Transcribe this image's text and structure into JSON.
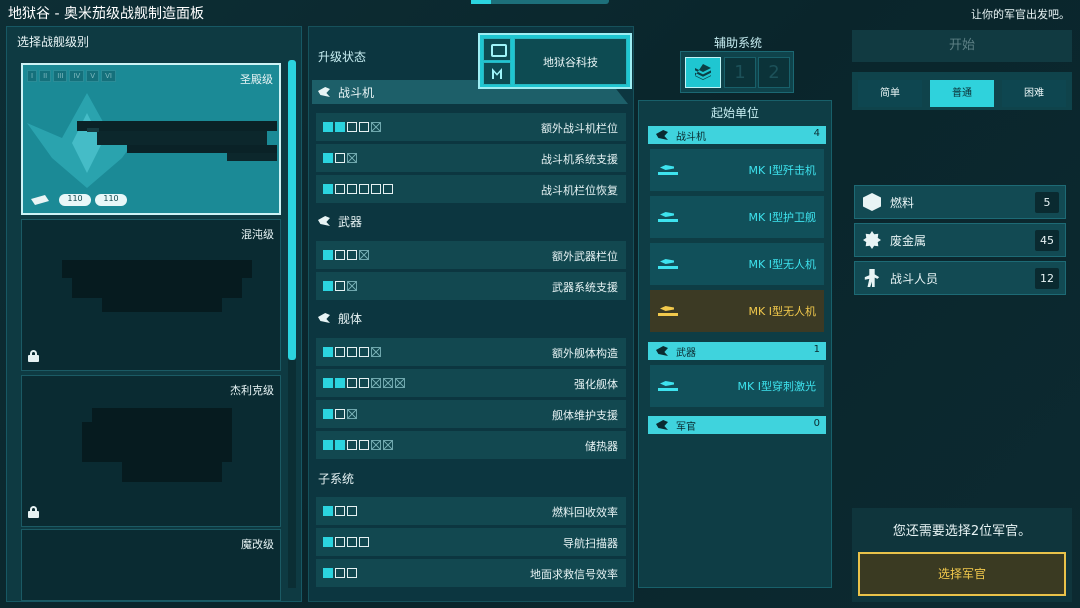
{
  "window": {
    "title": "地狱谷 - 奥米茄级战舰制造面板",
    "tagline": "让你的军官出发吧。"
  },
  "ship_select": {
    "title": "选择战舰级别",
    "roman": [
      "I",
      "II",
      "III",
      "IV",
      "V",
      "VI"
    ],
    "ships": [
      {
        "name": "圣殿级",
        "selected": true,
        "locked": false,
        "stats": [
          "110",
          "110"
        ]
      },
      {
        "name": "混沌级",
        "selected": false,
        "locked": true
      },
      {
        "name": "杰利克级",
        "selected": false,
        "locked": true
      },
      {
        "name": "魔改级",
        "selected": false,
        "locked": false
      }
    ]
  },
  "upgrades": {
    "title": "升级状态",
    "categories": [
      {
        "label": "战斗机",
        "rows": [
          {
            "label": "额外战斗机栏位",
            "boxes": "ffeex"
          },
          {
            "label": "战斗机系统支援",
            "boxes": "fex"
          },
          {
            "label": "战斗机栏位恢复",
            "boxes": "feeeee"
          }
        ]
      },
      {
        "label": "武器",
        "rows": [
          {
            "label": "额外武器栏位",
            "boxes": "feex"
          },
          {
            "label": "武器系统支援",
            "boxes": "fex"
          }
        ]
      },
      {
        "label": "舰体",
        "rows": [
          {
            "label": "额外舰体构造",
            "boxes": "feeex"
          },
          {
            "label": "强化舰体",
            "boxes": "ffeexxx"
          },
          {
            "label": "舰体维护支援",
            "boxes": "fex"
          },
          {
            "label": "储热器",
            "boxes": "ffeexx"
          }
        ]
      }
    ],
    "subsystems": {
      "label": "子系统",
      "rows": [
        {
          "label": "燃料回收效率",
          "boxes": "fee"
        },
        {
          "label": "导航扫描器",
          "boxes": "feee"
        },
        {
          "label": "地面求救信号效率",
          "boxes": "fee"
        }
      ]
    }
  },
  "tech": {
    "label": "地狱谷科技"
  },
  "auxiliary": {
    "title": "辅助系统",
    "slots": [
      "1",
      "2"
    ]
  },
  "starting_units": {
    "title": "起始单位",
    "groups": [
      {
        "label": "战斗机",
        "count": "4",
        "items": [
          {
            "name": "MK I型歼击机",
            "highlight": false
          },
          {
            "name": "MK I型护卫舰",
            "highlight": false
          },
          {
            "name": "MK I型无人机",
            "highlight": false
          },
          {
            "name": "MK I型无人机",
            "highlight": true
          }
        ]
      },
      {
        "label": "武器",
        "count": "1",
        "items": [
          {
            "name": "MK I型穿刺激光",
            "highlight": false
          }
        ]
      },
      {
        "label": "军官",
        "count": "0",
        "items": []
      }
    ]
  },
  "start": {
    "label": "开始"
  },
  "difficulty": {
    "options": [
      "简单",
      "普通",
      "困难"
    ],
    "selected": "普通"
  },
  "resources": [
    {
      "name": "燃料",
      "value": "5",
      "icon": "fuel-icon"
    },
    {
      "name": "废金属",
      "value": "45",
      "icon": "scrap-icon"
    },
    {
      "name": "战斗人员",
      "value": "12",
      "icon": "crew-icon"
    }
  ],
  "officers": {
    "message": "您还需要选择2位军官。",
    "button": "选择军官"
  },
  "colors": {
    "accent": "#2bd4df",
    "gold": "#f2c94c",
    "panel": "#0e3a42"
  }
}
